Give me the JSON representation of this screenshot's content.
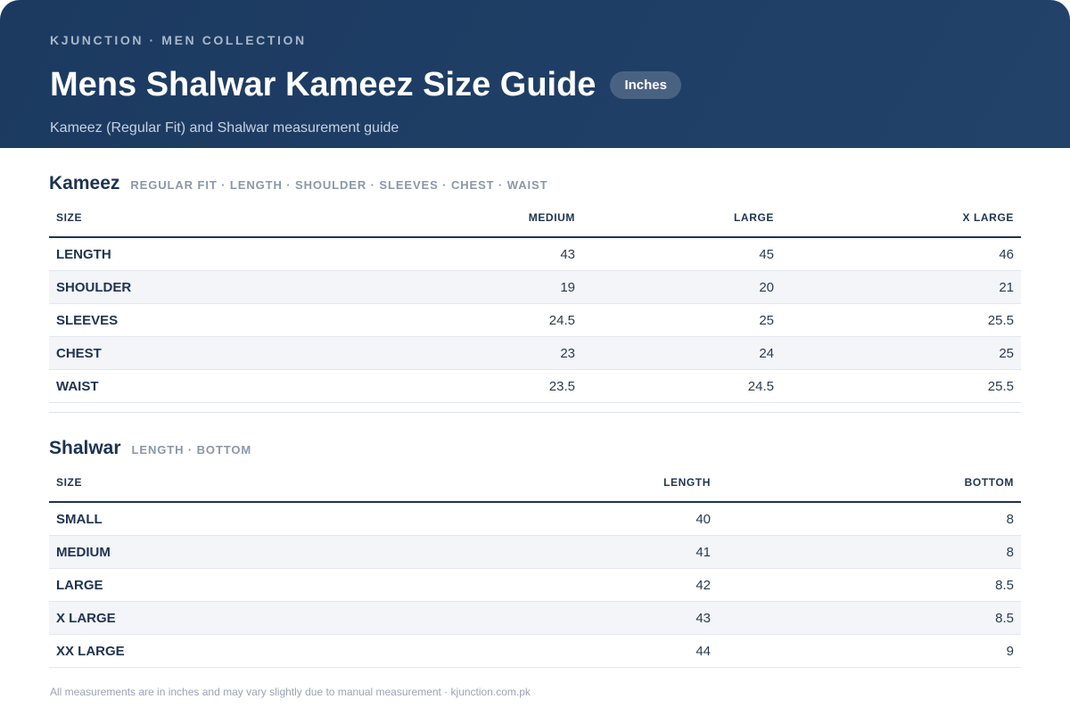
{
  "header": {
    "eyebrow": "KJUNCTION · MEN COLLECTION",
    "title": "Mens Shalwar Kameez Size Guide",
    "unit_badge": "Inches",
    "subtitle": "Kameez (Regular Fit) and Shalwar measurement guide"
  },
  "kameez": {
    "title": "Kameez",
    "tags": "REGULAR FIT · LENGTH · SHOULDER · SLEEVES · CHEST · WAIST",
    "columns": [
      "SIZE",
      "MEDIUM",
      "LARGE",
      "X LARGE"
    ],
    "rows": [
      {
        "label": "LENGTH",
        "values": [
          "43",
          "45",
          "46"
        ]
      },
      {
        "label": "SHOULDER",
        "values": [
          "19",
          "20",
          "21"
        ]
      },
      {
        "label": "SLEEVES",
        "values": [
          "24.5",
          "25",
          "25.5"
        ]
      },
      {
        "label": "CHEST",
        "values": [
          "23",
          "24",
          "25"
        ]
      },
      {
        "label": "WAIST",
        "values": [
          "23.5",
          "24.5",
          "25.5"
        ]
      }
    ]
  },
  "shalwar": {
    "title": "Shalwar",
    "tags": "LENGTH · BOTTOM",
    "columns": [
      "SIZE",
      "LENGTH",
      "BOTTOM"
    ],
    "rows": [
      {
        "label": "SMALL",
        "values": [
          "40",
          "8"
        ]
      },
      {
        "label": "MEDIUM",
        "values": [
          "41",
          "8"
        ]
      },
      {
        "label": "LARGE",
        "values": [
          "42",
          "8.5"
        ]
      },
      {
        "label": "X LARGE",
        "values": [
          "43",
          "8.5"
        ]
      },
      {
        "label": "XX LARGE",
        "values": [
          "44",
          "9"
        ]
      }
    ]
  },
  "footer": {
    "note": "All measurements are in inches and may vary slightly due to manual measurement · kjunction.com.pk"
  }
}
